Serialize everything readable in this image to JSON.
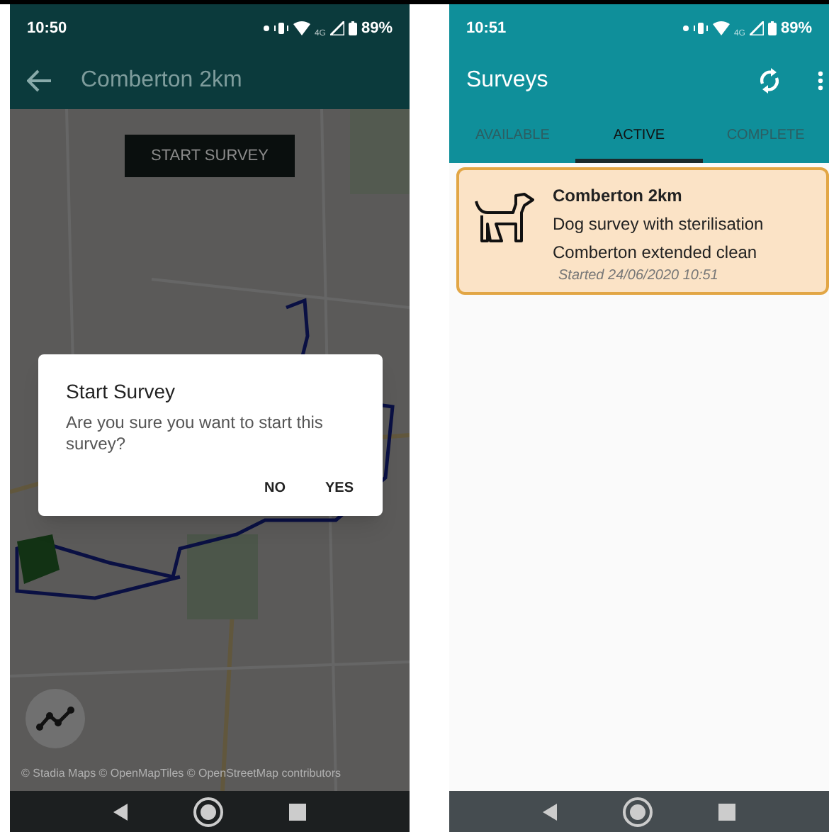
{
  "left_screen": {
    "status_bar": {
      "time": "10:50",
      "network": "4G",
      "battery": "89%"
    },
    "app_bar": {
      "title": "Comberton 2km"
    },
    "map": {
      "start_button": "START SURVEY",
      "attribution": "© Stadia Maps © OpenMapTiles © OpenStreetMap contributors"
    },
    "dialog": {
      "title": "Start Survey",
      "message": "Are you sure you want to start this survey?",
      "buttons": [
        "NO",
        "YES"
      ]
    }
  },
  "right_screen": {
    "status_bar": {
      "time": "10:51",
      "network": "4G",
      "battery": "89%"
    },
    "app_bar": {
      "title": "Surveys"
    },
    "tabs": [
      {
        "label": "AVAILABLE",
        "selected": false
      },
      {
        "label": "ACTIVE",
        "selected": true
      },
      {
        "label": "COMPLETE",
        "selected": false
      }
    ],
    "surveys": [
      {
        "title": "Comberton 2km",
        "line_1": "Dog survey with sterilisation",
        "line_2": "Comberton extended clean",
        "started": "Started 24/06/2020 10:51"
      }
    ]
  }
}
